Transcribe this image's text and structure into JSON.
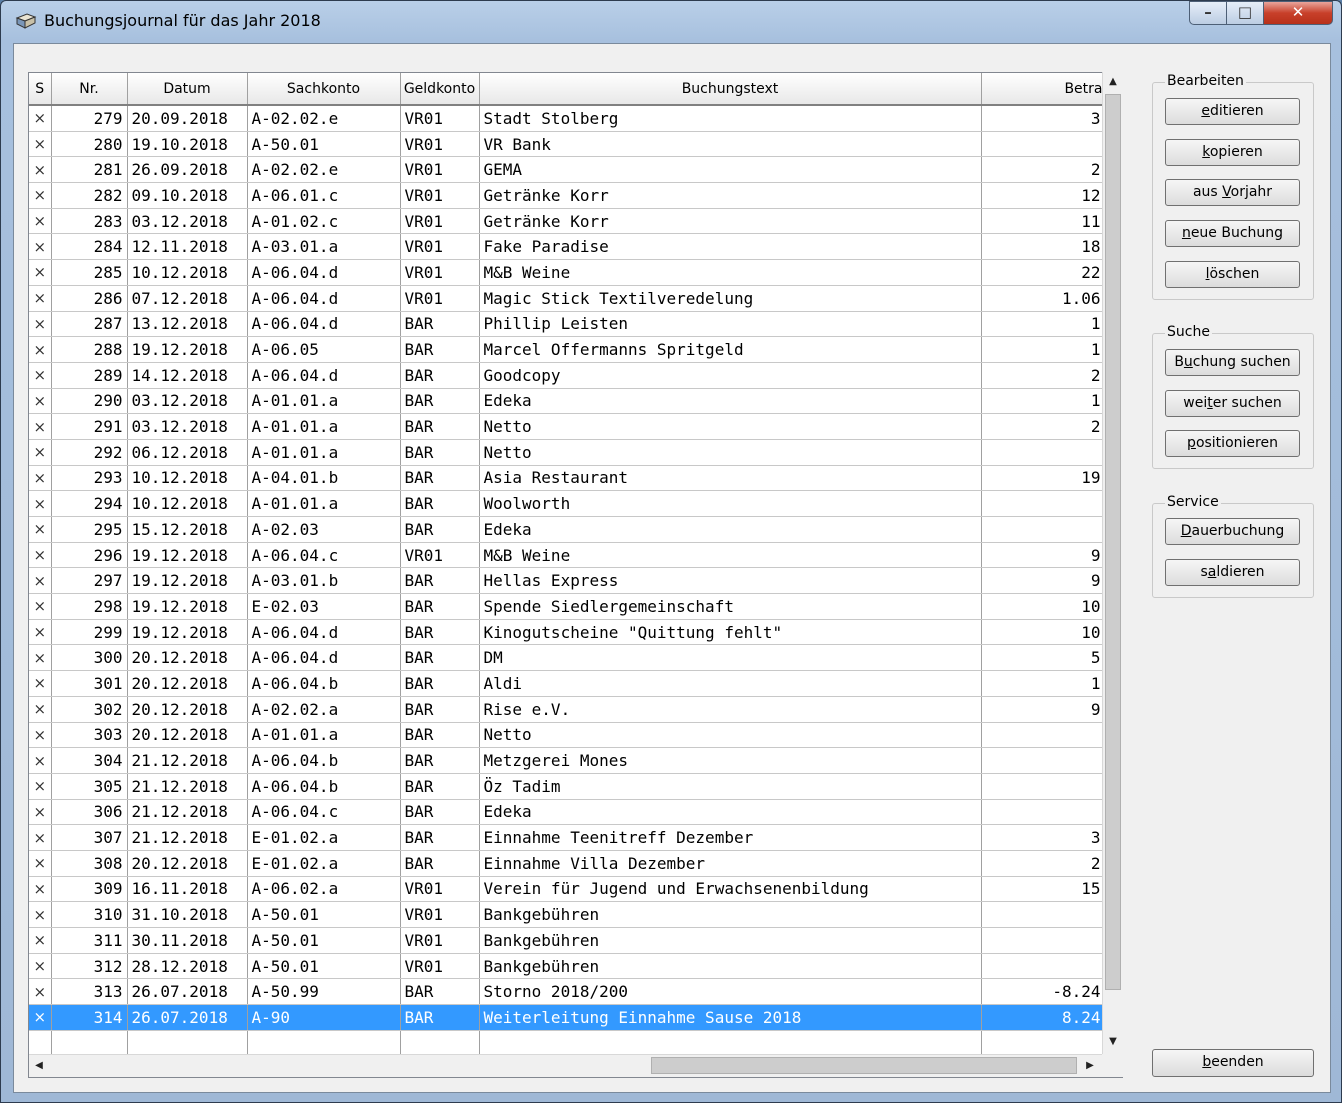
{
  "window": {
    "title": "Buchungsjournal für das Jahr 2018",
    "minimize_glyph": "–",
    "maximize_glyph": "□",
    "close_glyph": "✕"
  },
  "table": {
    "columns": [
      "S",
      "Nr.",
      "Datum",
      "Sachkonto",
      "Geldkonto",
      "Buchungstext",
      "Betra"
    ],
    "rows": [
      {
        "s": "×",
        "nr": "279",
        "datum": "20.09.2018",
        "sachkonto": "A-02.02.e",
        "geldkonto": "VR01",
        "text": "Stadt Stolberg",
        "betrag": "3"
      },
      {
        "s": "×",
        "nr": "280",
        "datum": "19.10.2018",
        "sachkonto": "A-50.01",
        "geldkonto": "VR01",
        "text": "VR Bank",
        "betrag": ""
      },
      {
        "s": "×",
        "nr": "281",
        "datum": "26.09.2018",
        "sachkonto": "A-02.02.e",
        "geldkonto": "VR01",
        "text": "GEMA",
        "betrag": "2"
      },
      {
        "s": "×",
        "nr": "282",
        "datum": "09.10.2018",
        "sachkonto": "A-06.01.c",
        "geldkonto": "VR01",
        "text": "Getränke Korr",
        "betrag": "12"
      },
      {
        "s": "×",
        "nr": "283",
        "datum": "03.12.2018",
        "sachkonto": "A-01.02.c",
        "geldkonto": "VR01",
        "text": "Getränke Korr",
        "betrag": "11"
      },
      {
        "s": "×",
        "nr": "284",
        "datum": "12.11.2018",
        "sachkonto": "A-03.01.a",
        "geldkonto": "VR01",
        "text": "Fake Paradise",
        "betrag": "18"
      },
      {
        "s": "×",
        "nr": "285",
        "datum": "10.12.2018",
        "sachkonto": "A-06.04.d",
        "geldkonto": "VR01",
        "text": "M&B Weine",
        "betrag": "22"
      },
      {
        "s": "×",
        "nr": "286",
        "datum": "07.12.2018",
        "sachkonto": "A-06.04.d",
        "geldkonto": "VR01",
        "text": "Magic Stick Textilveredelung",
        "betrag": "1.06"
      },
      {
        "s": "×",
        "nr": "287",
        "datum": "13.12.2018",
        "sachkonto": "A-06.04.d",
        "geldkonto": "BAR",
        "text": "Phillip Leisten",
        "betrag": "1"
      },
      {
        "s": "×",
        "nr": "288",
        "datum": "19.12.2018",
        "sachkonto": "A-06.05",
        "geldkonto": "BAR",
        "text": "Marcel Offermanns Spritgeld",
        "betrag": "1"
      },
      {
        "s": "×",
        "nr": "289",
        "datum": "14.12.2018",
        "sachkonto": "A-06.04.d",
        "geldkonto": "BAR",
        "text": "Goodcopy",
        "betrag": "2"
      },
      {
        "s": "×",
        "nr": "290",
        "datum": "03.12.2018",
        "sachkonto": "A-01.01.a",
        "geldkonto": "BAR",
        "text": "Edeka",
        "betrag": "1"
      },
      {
        "s": "×",
        "nr": "291",
        "datum": "03.12.2018",
        "sachkonto": "A-01.01.a",
        "geldkonto": "BAR",
        "text": "Netto",
        "betrag": "2"
      },
      {
        "s": "×",
        "nr": "292",
        "datum": "06.12.2018",
        "sachkonto": "A-01.01.a",
        "geldkonto": "BAR",
        "text": "Netto",
        "betrag": ""
      },
      {
        "s": "×",
        "nr": "293",
        "datum": "10.12.2018",
        "sachkonto": "A-04.01.b",
        "geldkonto": "BAR",
        "text": "Asia Restaurant",
        "betrag": "19"
      },
      {
        "s": "×",
        "nr": "294",
        "datum": "10.12.2018",
        "sachkonto": "A-01.01.a",
        "geldkonto": "BAR",
        "text": "Woolworth",
        "betrag": ""
      },
      {
        "s": "×",
        "nr": "295",
        "datum": "15.12.2018",
        "sachkonto": "A-02.03",
        "geldkonto": "BAR",
        "text": "Edeka",
        "betrag": ""
      },
      {
        "s": "×",
        "nr": "296",
        "datum": "19.12.2018",
        "sachkonto": "A-06.04.c",
        "geldkonto": "VR01",
        "text": "M&B Weine",
        "betrag": "9"
      },
      {
        "s": "×",
        "nr": "297",
        "datum": "19.12.2018",
        "sachkonto": "A-03.01.b",
        "geldkonto": "BAR",
        "text": "Hellas Express",
        "betrag": "9"
      },
      {
        "s": "×",
        "nr": "298",
        "datum": "19.12.2018",
        "sachkonto": "E-02.03",
        "geldkonto": "BAR",
        "text": "Spende Siedlergemeinschaft",
        "betrag": "10"
      },
      {
        "s": "×",
        "nr": "299",
        "datum": "19.12.2018",
        "sachkonto": "A-06.04.d",
        "geldkonto": "BAR",
        "text": "Kinogutscheine \"Quittung fehlt\"",
        "betrag": "10"
      },
      {
        "s": "×",
        "nr": "300",
        "datum": "20.12.2018",
        "sachkonto": "A-06.04.d",
        "geldkonto": "BAR",
        "text": "DM",
        "betrag": "5"
      },
      {
        "s": "×",
        "nr": "301",
        "datum": "20.12.2018",
        "sachkonto": "A-06.04.b",
        "geldkonto": "BAR",
        "text": "Aldi",
        "betrag": "1"
      },
      {
        "s": "×",
        "nr": "302",
        "datum": "20.12.2018",
        "sachkonto": "A-02.02.a",
        "geldkonto": "BAR",
        "text": "Rise e.V.",
        "betrag": "9"
      },
      {
        "s": "×",
        "nr": "303",
        "datum": "20.12.2018",
        "sachkonto": "A-01.01.a",
        "geldkonto": "BAR",
        "text": "Netto",
        "betrag": ""
      },
      {
        "s": "×",
        "nr": "304",
        "datum": "21.12.2018",
        "sachkonto": "A-06.04.b",
        "geldkonto": "BAR",
        "text": "Metzgerei Mones",
        "betrag": ""
      },
      {
        "s": "×",
        "nr": "305",
        "datum": "21.12.2018",
        "sachkonto": "A-06.04.b",
        "geldkonto": "BAR",
        "text": "Öz Tadim",
        "betrag": ""
      },
      {
        "s": "×",
        "nr": "306",
        "datum": "21.12.2018",
        "sachkonto": "A-06.04.c",
        "geldkonto": "BAR",
        "text": "Edeka",
        "betrag": ""
      },
      {
        "s": "×",
        "nr": "307",
        "datum": "21.12.2018",
        "sachkonto": "E-01.02.a",
        "geldkonto": "BAR",
        "text": "Einnahme Teenitreff Dezember",
        "betrag": "3"
      },
      {
        "s": "×",
        "nr": "308",
        "datum": "20.12.2018",
        "sachkonto": "E-01.02.a",
        "geldkonto": "BAR",
        "text": "Einnahme Villa Dezember",
        "betrag": "2"
      },
      {
        "s": "×",
        "nr": "309",
        "datum": "16.11.2018",
        "sachkonto": "A-06.02.a",
        "geldkonto": "VR01",
        "text": "Verein für Jugend und Erwachsenenbildung",
        "betrag": "15"
      },
      {
        "s": "×",
        "nr": "310",
        "datum": "31.10.2018",
        "sachkonto": "A-50.01",
        "geldkonto": "VR01",
        "text": "Bankgebühren",
        "betrag": ""
      },
      {
        "s": "×",
        "nr": "311",
        "datum": "30.11.2018",
        "sachkonto": "A-50.01",
        "geldkonto": "VR01",
        "text": "Bankgebühren",
        "betrag": ""
      },
      {
        "s": "×",
        "nr": "312",
        "datum": "28.12.2018",
        "sachkonto": "A-50.01",
        "geldkonto": "VR01",
        "text": "Bankgebühren",
        "betrag": ""
      },
      {
        "s": "×",
        "nr": "313",
        "datum": "26.07.2018",
        "sachkonto": "A-50.99",
        "geldkonto": "BAR",
        "text": "Storno 2018/200",
        "betrag": "-8.24"
      },
      {
        "s": "×",
        "nr": "314",
        "datum": "26.07.2018",
        "sachkonto": "A-90",
        "geldkonto": "BAR",
        "text": "Weiterleitung Einnahme Sause 2018",
        "betrag": "8.24",
        "selected": true
      }
    ]
  },
  "groups": {
    "bearbeiten": {
      "label": "Bearbeiten",
      "buttons": [
        {
          "pre": "",
          "acc": "e",
          "post": "ditieren"
        },
        {
          "pre": "",
          "acc": "k",
          "post": "opieren"
        },
        {
          "pre": "aus ",
          "acc": "V",
          "post": "orjahr"
        },
        {
          "pre": "",
          "acc": "n",
          "post": "eue Buchung"
        },
        {
          "pre": "",
          "acc": "l",
          "post": "öschen"
        }
      ]
    },
    "suche": {
      "label": "Suche",
      "buttons": [
        {
          "pre": "B",
          "acc": "u",
          "post": "chung suchen"
        },
        {
          "pre": "wei",
          "acc": "t",
          "post": "er suchen"
        },
        {
          "pre": "",
          "acc": "p",
          "post": "ositionieren"
        }
      ]
    },
    "service": {
      "label": "Service",
      "buttons": [
        {
          "pre": "",
          "acc": "D",
          "post": "auerbuchung"
        },
        {
          "pre": "s",
          "acc": "a",
          "post": "ldieren"
        }
      ]
    }
  },
  "footer": {
    "close_button": {
      "pre": "",
      "acc": "b",
      "post": "eenden"
    }
  },
  "scroll": {
    "up_arrow": "▲",
    "down_arrow": "▼",
    "left_arrow": "◀",
    "right_arrow": "▶"
  }
}
